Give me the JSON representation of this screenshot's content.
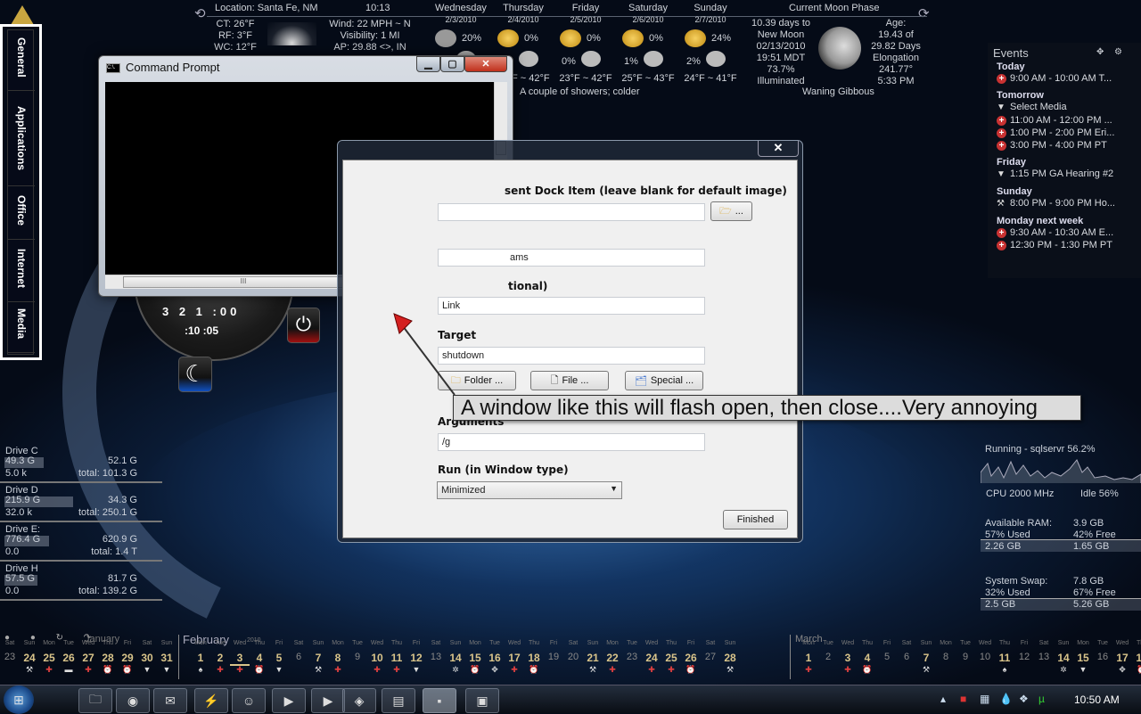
{
  "weather": {
    "location": "Location: Santa Fe, NM",
    "time": "10:13",
    "current": [
      "CT: 26°F",
      "RF: 3°F",
      "WC: 12°F"
    ],
    "conditions": [
      "Wind: 22 MPH ~ N",
      "Visibility: 1 MI",
      "AP: 29.88 <>, IN"
    ],
    "days": [
      {
        "name": "Wednesday",
        "date": "2/3/2010",
        "pct": "20%",
        "pct2": "",
        "temp": "~ 42°F"
      },
      {
        "name": "Thursday",
        "date": "2/4/2010",
        "pct": "0%",
        "pct2": "",
        "temp": "23°F ~ 42°F"
      },
      {
        "name": "Friday",
        "date": "2/5/2010",
        "pct": "0%",
        "pct2": "0%",
        "temp": "23°F ~ 42°F"
      },
      {
        "name": "Saturday",
        "date": "2/6/2010",
        "pct": "0%",
        "pct2": "1%",
        "temp": "25°F ~ 43°F"
      },
      {
        "name": "Sunday",
        "date": "2/7/2010",
        "pct": "24%",
        "pct2": "2%",
        "temp": "24°F ~ 41°F"
      }
    ],
    "forecast_text": "A couple of showers; colder",
    "moon": {
      "title": "Current Moon Phase",
      "left": [
        "10.39 days to",
        "New Moon",
        "02/13/2010",
        "19:51 MDT",
        "73.7%",
        "Illuminated"
      ],
      "right": [
        "Age:",
        "19.43 of",
        "29.82 Days",
        "Elongation",
        "241.77°",
        "5:33 PM"
      ],
      "phase": "Waning Gibbous"
    }
  },
  "dock": {
    "tabs": [
      "General",
      "Applications",
      "Office",
      "Internet",
      "Media"
    ]
  },
  "cmd": {
    "title": "Command Prompt",
    "icon_text": "C:\\."
  },
  "dialog": {
    "label1": "sent Dock Item (leave blank for default image)",
    "field1": "",
    "field2": "ams",
    "label3": "tional)",
    "field3": "Link",
    "target_label": "Target",
    "target": "shutdown",
    "browse_label": "...",
    "folder_btn": "Folder ...",
    "file_btn": "File ...",
    "special_btn": "Special ...",
    "args_label": "Arguments",
    "args": "/g",
    "run_label": "Run (in  Window type)",
    "run_value": "Minimized",
    "finished": "Finished",
    "close": "✕"
  },
  "callout": "A window like this will flash open, then close....Very annoying",
  "events": {
    "title": "Events",
    "groups": [
      {
        "day": "Today",
        "items": [
          {
            "icon": "plus",
            "text": "9:00 AM - 10:00 AM T..."
          }
        ]
      },
      {
        "day": "Tomorrow",
        "items": [
          {
            "icon": "warn",
            "text": "Select Media"
          },
          {
            "icon": "plus",
            "text": "11:00 AM - 12:00 PM ..."
          },
          {
            "icon": "plus",
            "text": "1:00 PM - 2:00 PM Eri..."
          },
          {
            "icon": "plus",
            "text": "3:00 PM - 4:00 PM PT"
          }
        ]
      },
      {
        "day": "Friday",
        "items": [
          {
            "icon": "warn",
            "text": "1:15 PM GA Hearing #2"
          }
        ]
      },
      {
        "day": "Sunday",
        "items": [
          {
            "icon": "tools",
            "text": "8:00 PM - 9:00 PM Ho..."
          }
        ]
      },
      {
        "day": "Monday next week",
        "items": [
          {
            "icon": "plus",
            "text": "9:30 AM - 10:30 AM E..."
          },
          {
            "icon": "plus",
            "text": "12:30 PM - 1:30 PM PT"
          }
        ]
      }
    ]
  },
  "drives": [
    {
      "name": "Drive C",
      "used": "49.3 G",
      "free": "52.1 G",
      "io": "5.0 k",
      "total": "total: 101.3 G",
      "used_frac": 0.49
    },
    {
      "name": "Drive D",
      "used": "215.9 G",
      "free": "34.3 G",
      "io": "32.0 k",
      "total": "total: 250.1 G",
      "used_frac": 0.86
    },
    {
      "name": "Drive E:",
      "used": "776.4 G",
      "free": "620.9 G",
      "io": "0.0",
      "total": "total: 1.4 T",
      "used_frac": 0.55
    },
    {
      "name": "Drive H",
      "used": "57.5 G",
      "free": "81.7 G",
      "io": "0.0",
      "total": "total: 139.2 G",
      "used_frac": 0.41
    }
  ],
  "system": {
    "running": "Running - sqlservr 56.2%",
    "cpu": "CPU 2000 MHz",
    "idle": "Idle 56%",
    "ram": [
      "Available RAM:",
      "3.9 GB",
      "57% Used",
      "42% Free",
      "2.26 GB",
      "1.65 GB"
    ],
    "swap": [
      "System Swap:",
      "7.8 GB",
      "32% Used",
      "67% Free",
      "2.5 GB",
      "5.26 GB"
    ]
  },
  "calendar": {
    "months": [
      "January",
      "February",
      "March"
    ],
    "year": "2010",
    "nav_icons": [
      "info",
      "info",
      "refresh",
      "forward"
    ],
    "days": [
      [
        "Sat",
        "23",
        0,
        ""
      ],
      [
        "Sun",
        "24",
        1,
        "tools"
      ],
      [
        "Mon",
        "25",
        1,
        "plus"
      ],
      [
        "Tue",
        "26",
        1,
        "car"
      ],
      [
        "Wed",
        "27",
        1,
        "plus"
      ],
      [
        "Thu",
        "28",
        1,
        "bell"
      ],
      [
        "Fri",
        "29",
        1,
        "bell"
      ],
      [
        "Sat",
        "30",
        1,
        "warn"
      ],
      [
        "Sun",
        "31",
        1,
        "warn"
      ],
      [
        "Mon",
        "1",
        1,
        "spade"
      ],
      [
        "Tue",
        "2",
        1,
        "plus"
      ],
      [
        "Wed",
        "3",
        1,
        "plus"
      ],
      [
        "Thu",
        "4",
        1,
        "bell"
      ],
      [
        "Fri",
        "5",
        1,
        "warn"
      ],
      [
        "Sat",
        "6",
        0,
        ""
      ],
      [
        "Sun",
        "7",
        1,
        "tools"
      ],
      [
        "Mon",
        "8",
        1,
        "plus"
      ],
      [
        "Tue",
        "9",
        0,
        ""
      ],
      [
        "Wed",
        "10",
        1,
        "plus"
      ],
      [
        "Thu",
        "11",
        1,
        "plus"
      ],
      [
        "Fri",
        "12",
        1,
        "warn"
      ],
      [
        "Sat",
        "13",
        0,
        ""
      ],
      [
        "Sun",
        "14",
        1,
        "gear"
      ],
      [
        "Mon",
        "15",
        1,
        "bell"
      ],
      [
        "Tue",
        "16",
        1,
        "diamond"
      ],
      [
        "Wed",
        "17",
        1,
        "plus"
      ],
      [
        "Thu",
        "18",
        1,
        "bell"
      ],
      [
        "Fri",
        "19",
        0,
        ""
      ],
      [
        "Sat",
        "20",
        0,
        ""
      ],
      [
        "Sun",
        "21",
        1,
        "tools"
      ],
      [
        "Mon",
        "22",
        1,
        "plus"
      ],
      [
        "Tue",
        "23",
        0,
        ""
      ],
      [
        "Wed",
        "24",
        1,
        "plus"
      ],
      [
        "Thu",
        "25",
        1,
        "plus"
      ],
      [
        "Fri",
        "26",
        1,
        "bell"
      ],
      [
        "Sat",
        "27",
        0,
        ""
      ],
      [
        "Sun",
        "28",
        1,
        "tools"
      ],
      [
        "Mon",
        "1",
        1,
        "plus"
      ],
      [
        "Tue",
        "2",
        0,
        ""
      ],
      [
        "Wed",
        "3",
        1,
        "plus"
      ],
      [
        "Thu",
        "4",
        1,
        "bell"
      ],
      [
        "Fri",
        "5",
        0,
        ""
      ],
      [
        "Sat",
        "6",
        0,
        ""
      ],
      [
        "Sun",
        "7",
        1,
        "tools"
      ],
      [
        "Mon",
        "8",
        0,
        ""
      ],
      [
        "Tue",
        "9",
        0,
        ""
      ],
      [
        "Wed",
        "10",
        0,
        ""
      ],
      [
        "Thu",
        "11",
        1,
        "spade"
      ],
      [
        "Fri",
        "12",
        0,
        ""
      ],
      [
        "Sat",
        "13",
        0,
        ""
      ],
      [
        "Sun",
        "14",
        1,
        "gear"
      ],
      [
        "Mon",
        "15",
        1,
        "warn"
      ],
      [
        "Tue",
        "16",
        0,
        ""
      ],
      [
        "Wed",
        "17",
        1,
        "diamond"
      ],
      [
        "Thu",
        "18",
        1,
        "bell"
      ]
    ],
    "today": "3"
  },
  "taskbar": {
    "apps": [
      "explorer",
      "firefox",
      "thunderbird",
      "winamp",
      "messenger",
      "media-player",
      "video-player",
      "game",
      "notepad",
      "command-prompt",
      "remote-desktop"
    ],
    "clock": "10:50 AM",
    "tray": [
      "show-hidden",
      "antivirus",
      "network",
      "water-drop",
      "dropbox",
      "utorrent"
    ]
  },
  "colors": {
    "accent_gold": "#d9c48a",
    "event_red": "#c83232",
    "callout_bg": "#dcdcdc"
  }
}
